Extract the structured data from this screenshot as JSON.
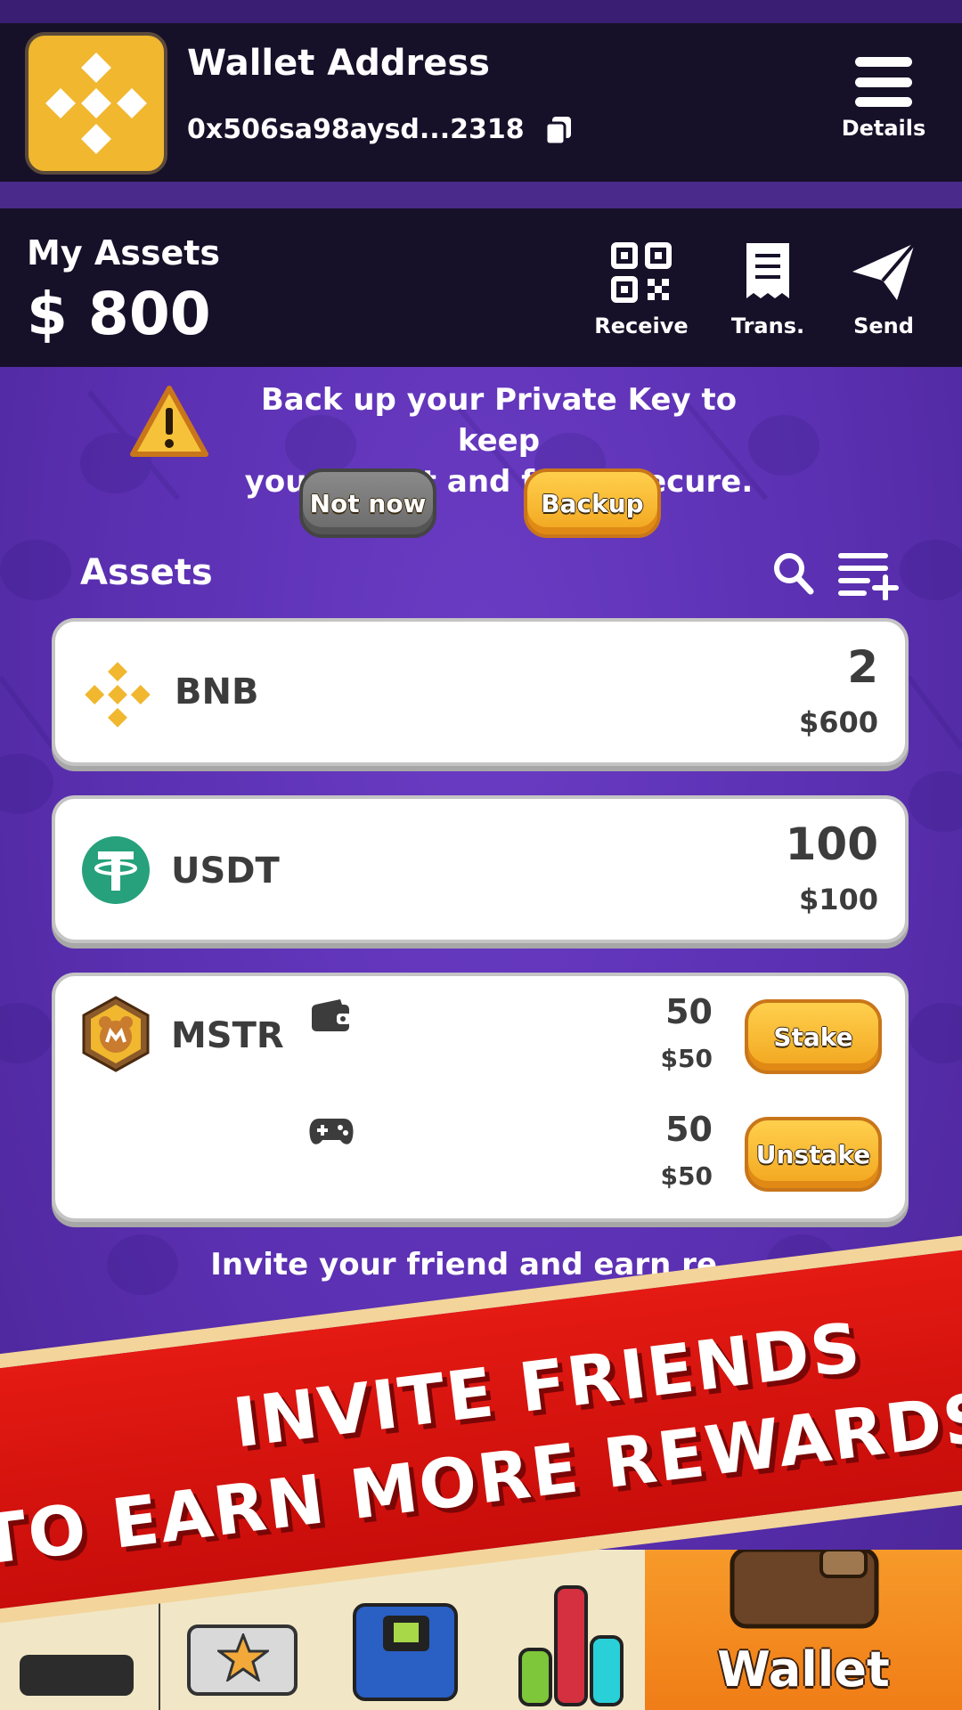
{
  "header": {
    "title": "Wallet Address",
    "address": "0x506sa98aysd...2318",
    "details_label": "Details"
  },
  "assets_bar": {
    "label": "My Assets",
    "value": "$ 800",
    "actions": [
      {
        "label": "Receive",
        "icon": "qr-code-icon"
      },
      {
        "label": "Trans.",
        "icon": "receipt-icon"
      },
      {
        "label": "Send",
        "icon": "paper-plane-icon"
      }
    ]
  },
  "backup_notice": {
    "text_line1": "Back up your Private Key to keep",
    "text_line2": "your wallet and funds secure.",
    "not_now_label": "Not now",
    "backup_label": "Backup"
  },
  "assets_list": {
    "heading": "Assets",
    "items": [
      {
        "symbol": "BNB",
        "amount": "2",
        "usd": "$600"
      },
      {
        "symbol": "USDT",
        "amount": "100",
        "usd": "$100"
      },
      {
        "symbol": "MSTR",
        "wallet_amount": "50",
        "wallet_usd": "$50",
        "game_amount": "50",
        "game_usd": "$50",
        "stake_label": "Stake",
        "unstake_label": "Unstake"
      }
    ]
  },
  "invite_line": "Invite your friend and earn re...",
  "banner": {
    "line1": "INVITE FRIENDS",
    "line2": "TO EARN MORE REWARDS"
  },
  "bottom_nav": {
    "active_label": "Wallet"
  },
  "colors": {
    "background": "#5a2fb0",
    "header": "#171029",
    "brand_yellow": "#f0b72f",
    "usdt_green": "#26a17b",
    "banner_red": "#d8140f",
    "active_tab": "#f28a1f"
  }
}
